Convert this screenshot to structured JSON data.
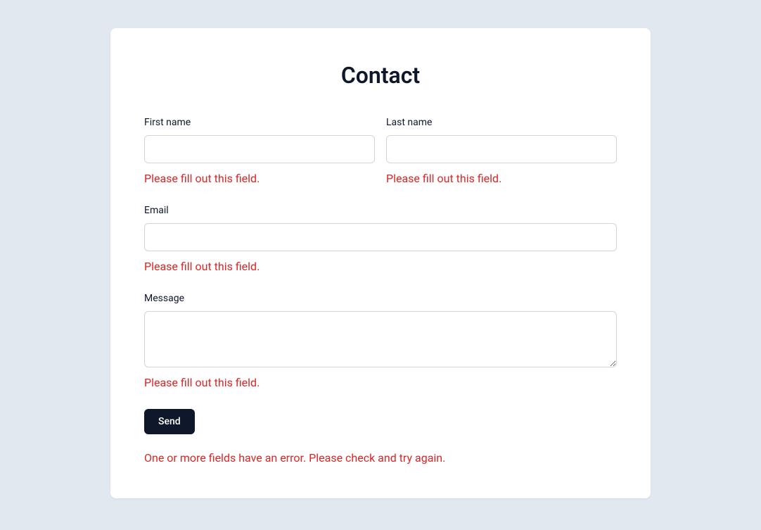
{
  "form": {
    "title": "Contact",
    "fields": {
      "first_name": {
        "label": "First name",
        "value": "",
        "error": "Please fill out this field."
      },
      "last_name": {
        "label": "Last name",
        "value": "",
        "error": "Please fill out this field."
      },
      "email": {
        "label": "Email",
        "value": "",
        "error": "Please fill out this field."
      },
      "message": {
        "label": "Message",
        "value": "",
        "error": "Please fill out this field."
      }
    },
    "submit_label": "Send",
    "form_error": "One or more fields have an error. Please check and try again."
  },
  "colors": {
    "background": "#e2e8f0",
    "card": "#ffffff",
    "text": "#0f172a",
    "error": "#dc2626",
    "border": "#d1d5db",
    "button_bg": "#0f172a",
    "button_text": "#ffffff"
  }
}
